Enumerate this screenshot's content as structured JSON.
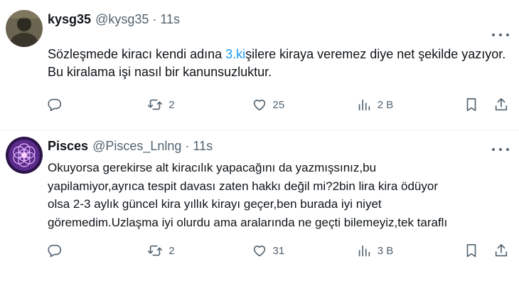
{
  "tweets": [
    {
      "name": "kysg35",
      "handle": "@kysg35",
      "separator": "·",
      "time": "11s",
      "text_before_link": "Sözleşmede kiracı kendi adına ",
      "link_text": "3.ki",
      "text_after_link": "şilere kiraya veremez diye net şekilde yazıyor. Bu kiralama işi nasıl bir kanunsuzluktur.",
      "retweets": "2",
      "likes": "25",
      "views": "2 B"
    },
    {
      "name": "Pisces",
      "handle": "@Pisces_Lnlng",
      "separator": "·",
      "time": "11s",
      "lines": [
        "Okuyorsa gerekirse alt kiracılık yapacağını da yazmışsınız,bu",
        "yapilamiyor,ayrıca tespit davası zaten hakkı değil mi?2bin lira kira ödüyor",
        "olsa 2-3 aylık güncel kira yıllık kirayı geçer,ben burada iyi niyet",
        "göremedim.Uzlaşma iyi olurdu ama aralarında ne geçti bilemeyiz,tek taraflı"
      ],
      "retweets": "2",
      "likes": "31",
      "views": "3 B"
    }
  ],
  "colors": {
    "link": "#1d9bf0",
    "secondary_text": "#536471",
    "primary_text": "#0f1419",
    "divider": "#eff3f4"
  },
  "icons": [
    "reply-icon",
    "retweet-icon",
    "like-icon",
    "views-icon",
    "bookmark-icon",
    "share-icon",
    "more-icon"
  ]
}
